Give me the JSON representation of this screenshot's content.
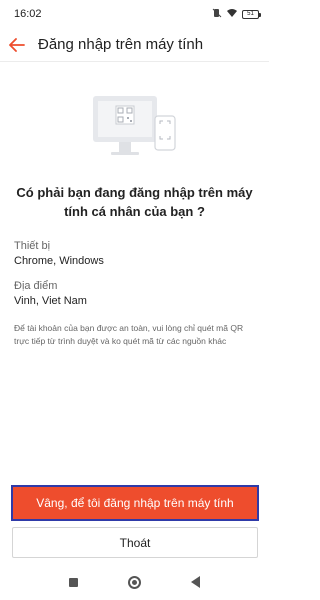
{
  "status_bar": {
    "time": "16:02",
    "battery": "51",
    "icons": [
      "mute-icon",
      "wifi-icon",
      "battery-icon"
    ]
  },
  "app_bar": {
    "back_icon": "arrow-left-icon",
    "title": "Đăng nhập trên máy tính"
  },
  "illustration": {
    "icon": "computer-qr-phone-illustration"
  },
  "question": "Có phải bạn đang đăng nhập trên máy tính cá nhân của bạn ?",
  "device": {
    "label": "Thiết bị",
    "value": "Chrome, Windows"
  },
  "location": {
    "label": "Địa điểm",
    "value": "Vinh, Viet Nam"
  },
  "note": "Để tài khoản của bạn được an toàn, vui lòng chỉ quét mã QR trực tiếp từ trình duyệt và ko quét mã từ các nguồn khác",
  "actions": {
    "confirm": "Vâng, để tôi đăng nhập trên máy tính",
    "exit": "Thoát"
  },
  "nav_bar": {
    "icons": [
      "recent-apps-icon",
      "home-icon",
      "back-icon"
    ]
  },
  "colors": {
    "accent": "#ee4d2d",
    "focus_outline": "#2f3aa8"
  }
}
